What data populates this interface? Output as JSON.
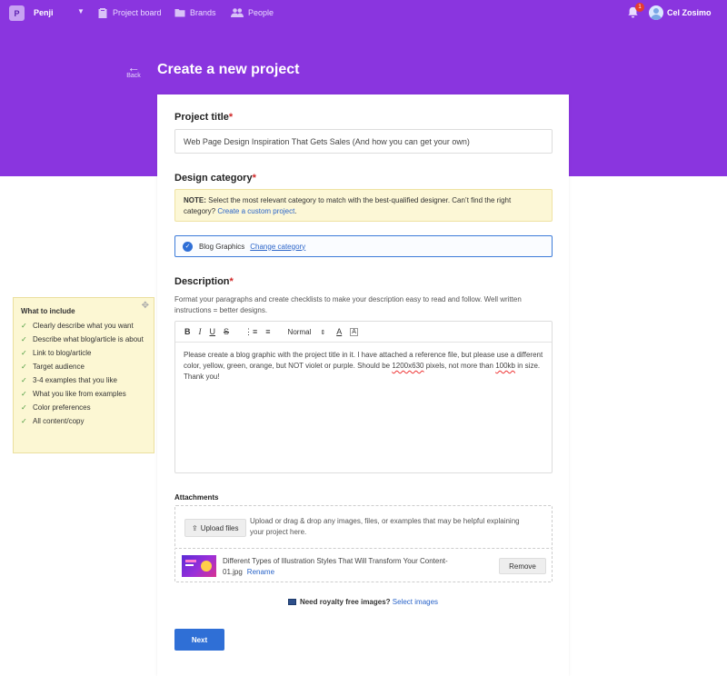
{
  "nav": {
    "workspace_initial": "P",
    "workspace_name": "Penji",
    "items": [
      {
        "label": "Project board",
        "icon": "clipboard-icon"
      },
      {
        "label": "Brands",
        "icon": "folder-icon"
      },
      {
        "label": "People",
        "icon": "people-icon"
      }
    ],
    "notification_count": "1",
    "user_name": "Cel Zosimo"
  },
  "header": {
    "back_label": "Back",
    "title": "Create a new project"
  },
  "form": {
    "project_title_label": "Project title",
    "project_title_value": "Web Page Design Inspiration That Gets Sales (And how you can get your own)",
    "category_label": "Design category",
    "note_prefix": "NOTE:",
    "note_text": " Select the most relevant category to match with the best-qualified designer. Can’t find the right category? ",
    "note_link": "Create a custom project",
    "note_suffix": ".",
    "selected_category": "Blog Graphics",
    "change_category": "Change category",
    "description_label": "Description",
    "description_helper": "Format your paragraphs and create checklists to make your description easy to read and follow. Well written instructions = better designs.",
    "toolbar": {
      "bold": "B",
      "italic": "I",
      "underline": "U",
      "strike": "S",
      "format_select": "Normal"
    },
    "description": {
      "part1": "Please create a blog graphic with the project title in it. I have attached a reference file, but please use a different color, yellow, green, orange, but NOT violet or purple. Should be ",
      "dims": "1200x630",
      "part2": " pixels, not more than ",
      "size": "100kb",
      "part3": " in size. Thank you!"
    },
    "attachments_label": "Attachments",
    "upload_button": "Upload files",
    "upload_hint": "Upload or drag & drop any images, files, or examples that may be helpful explaining your project here.",
    "file_name": "Different Types of Illustration Styles That Will Transform Your Content-01.jpg",
    "rename_label": "Rename",
    "remove_button": "Remove",
    "free_images_text": "Need royalty free images?",
    "free_images_link": "Select images",
    "next_button": "Next"
  },
  "tips": {
    "title": "What to include",
    "items": [
      "Clearly describe what you want",
      "Describe what blog/article is about",
      "Link to blog/article",
      "Target audience",
      "3-4 examples that you like",
      "What you like from examples",
      "Color preferences",
      "All content/copy"
    ]
  },
  "colors": {
    "brand_purple": "#8a35df",
    "primary_blue": "#2f6fd6",
    "note_yellow": "#fcf7d6",
    "required_red": "#d02626"
  }
}
